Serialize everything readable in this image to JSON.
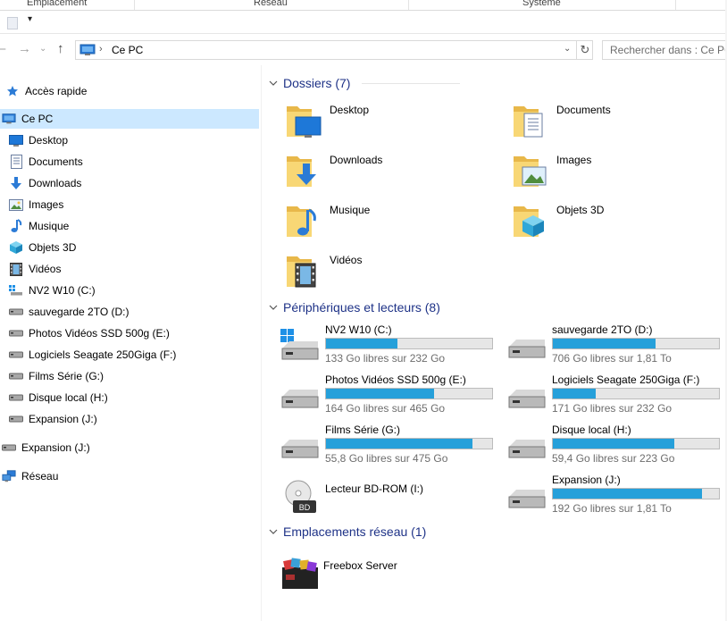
{
  "ribbon": {
    "groups": [
      "Emplacement",
      "Réseau",
      "Système"
    ]
  },
  "address": {
    "crumb": "Ce PC",
    "search_placeholder": "Rechercher dans : Ce PC"
  },
  "nav": {
    "quick_access": "Accès rapide",
    "this_pc": "Ce PC",
    "items": [
      {
        "label": "Desktop",
        "icon": "desktop-icon"
      },
      {
        "label": "Documents",
        "icon": "documents-icon"
      },
      {
        "label": "Downloads",
        "icon": "downloads-icon"
      },
      {
        "label": "Images",
        "icon": "images-icon"
      },
      {
        "label": "Musique",
        "icon": "music-icon"
      },
      {
        "label": "Objets 3D",
        "icon": "objects-3d-icon"
      },
      {
        "label": "Vidéos",
        "icon": "videos-icon"
      },
      {
        "label": "NV2 W10 (C:)",
        "icon": "drive-c-icon"
      },
      {
        "label": "sauvegarde 2TO (D:)",
        "icon": "drive-icon"
      },
      {
        "label": "Photos Vidéos SSD 500g (E:)",
        "icon": "drive-icon"
      },
      {
        "label": "Logiciels Seagate 250Giga (F:)",
        "icon": "drive-icon"
      },
      {
        "label": "Films Série (G:)",
        "icon": "drive-icon"
      },
      {
        "label": "Disque local (H:)",
        "icon": "drive-icon"
      },
      {
        "label": "Expansion (J:)",
        "icon": "drive-icon"
      }
    ],
    "expansion_root": "Expansion (J:)",
    "network": "Réseau"
  },
  "content": {
    "folders_title": "Dossiers (7)",
    "folders": [
      {
        "label": "Desktop",
        "icon": "desktop-folder-icon"
      },
      {
        "label": "Documents",
        "icon": "documents-folder-icon"
      },
      {
        "label": "Downloads",
        "icon": "downloads-folder-icon"
      },
      {
        "label": "Images",
        "icon": "images-folder-icon"
      },
      {
        "label": "Musique",
        "icon": "music-folder-icon"
      },
      {
        "label": "Objets 3D",
        "icon": "objects-3d-folder-icon"
      },
      {
        "label": "Vidéos",
        "icon": "videos-folder-icon"
      }
    ],
    "drives_title": "Périphériques et lecteurs (8)",
    "drives": [
      {
        "name": "NV2 W10 (C:)",
        "free": "133 Go libres sur 232 Go",
        "used_fraction": 0.43,
        "icon": "windows-drive-icon"
      },
      {
        "name": "sauvegarde 2TO (D:)",
        "free": "706 Go libres sur 1,81 To",
        "used_fraction": 0.62,
        "icon": "hard-drive-icon"
      },
      {
        "name": "Photos Vidéos SSD 500g (E:)",
        "free": "164 Go libres sur 465 Go",
        "used_fraction": 0.65,
        "icon": "hard-drive-icon"
      },
      {
        "name": "Logiciels Seagate 250Giga (F:)",
        "free": "171 Go libres sur 232 Go",
        "used_fraction": 0.26,
        "icon": "hard-drive-icon"
      },
      {
        "name": "Films Série (G:)",
        "free": "55,8 Go libres sur 475 Go",
        "used_fraction": 0.88,
        "icon": "hard-drive-icon"
      },
      {
        "name": "Disque local (H:)",
        "free": "59,4 Go libres sur 223 Go",
        "used_fraction": 0.73,
        "icon": "hard-drive-icon"
      },
      {
        "name": "Lecteur BD-ROM (I:)",
        "free": "",
        "used_fraction": null,
        "icon": "bd-rom-icon"
      },
      {
        "name": "Expansion (J:)",
        "free": "192 Go libres sur 1,81 To",
        "used_fraction": 0.9,
        "icon": "hard-drive-icon"
      }
    ],
    "network_title": "Emplacements réseau (1)",
    "network_items": [
      {
        "label": "Freebox Server",
        "icon": "media-server-icon"
      }
    ]
  },
  "colors": {
    "accent_blue": "#26a0da",
    "section_title": "#1e3287",
    "selection": "#cce8ff",
    "folder_yellow": "#f8d775"
  }
}
